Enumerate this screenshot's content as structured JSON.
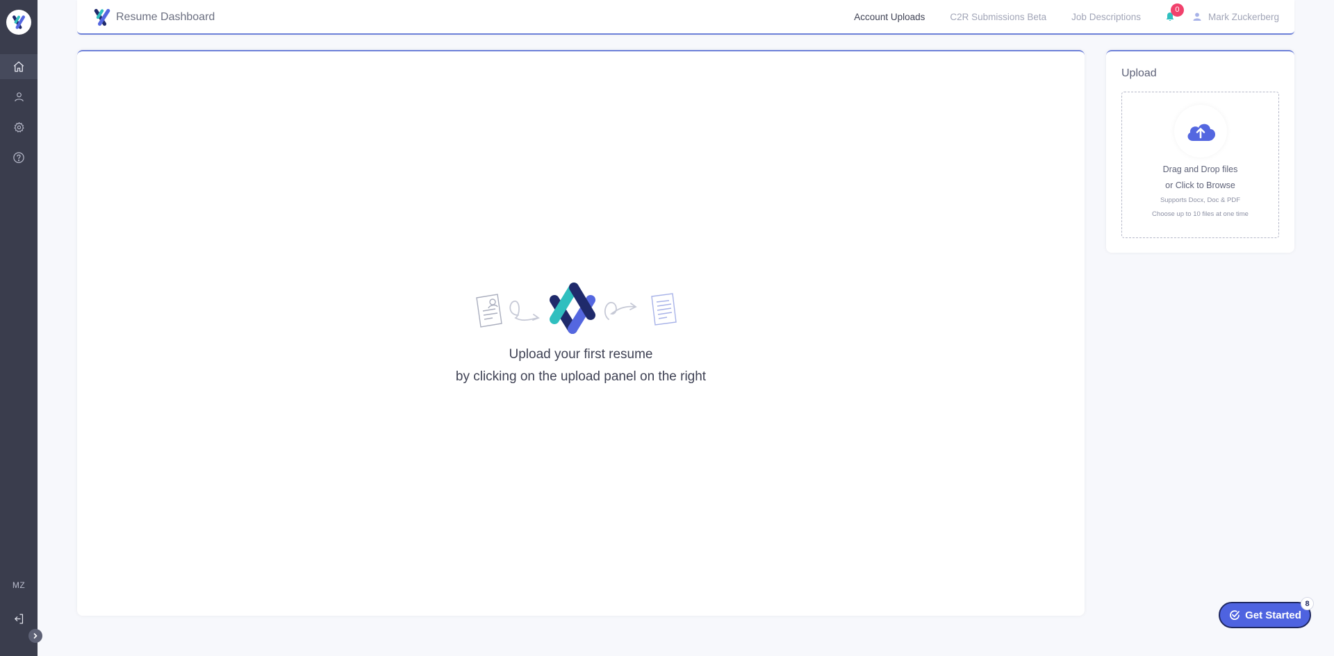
{
  "app": {
    "title": "Resume Dashboard",
    "brand_colors": {
      "accent": "#6c7fd8",
      "teal": "#2fbfbf",
      "navy": "#1f2a6b",
      "blue": "#5467e0"
    }
  },
  "sidebar": {
    "logo_icon": "logo-icon",
    "items": [
      {
        "name": "home",
        "icon": "home-icon",
        "active": true
      },
      {
        "name": "profile",
        "icon": "user-icon",
        "active": false
      },
      {
        "name": "settings",
        "icon": "gear-icon",
        "active": false
      },
      {
        "name": "help",
        "icon": "help-icon",
        "active": false
      }
    ],
    "initials": "MZ",
    "logout_icon": "logout-icon",
    "expand_icon": "chevron-right-icon"
  },
  "header": {
    "nav": [
      {
        "label": "Account Uploads",
        "active": true
      },
      {
        "label": "C2R Submissions Beta",
        "active": false
      },
      {
        "label": "Job Descriptions",
        "active": false
      }
    ],
    "notifications": {
      "icon": "bell-icon",
      "count": "0"
    },
    "user": {
      "icon": "user-icon",
      "name": "Mark Zuckerberg"
    }
  },
  "main": {
    "empty_state": {
      "line1": "Upload your first resume",
      "line2": "by clicking on the upload panel on the right"
    }
  },
  "upload": {
    "title": "Upload",
    "icon": "cloud-upload-icon",
    "line1": "Drag and Drop files",
    "line2": "or Click to Browse",
    "line3": "Supports Docx, Doc & PDF",
    "line4": "Choose up to 10 files at one time"
  },
  "get_started": {
    "label": "Get Started",
    "count": "8",
    "icon": "check-circle-icon"
  }
}
